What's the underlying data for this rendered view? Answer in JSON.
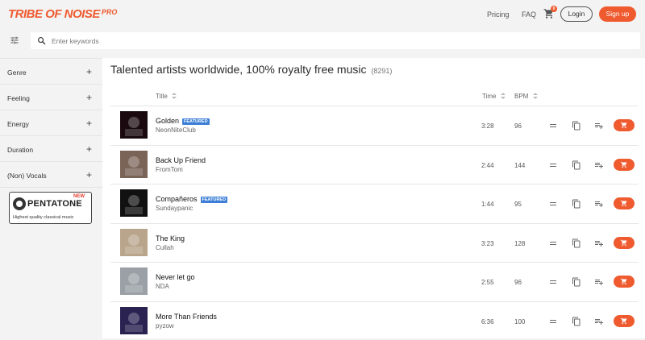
{
  "brand": {
    "name": "TRIBE OF NOISE",
    "tier": "PRO",
    "accent": "#ef5a2f"
  },
  "nav": {
    "pricing": "Pricing",
    "faq": "FAQ",
    "cart_count": "0",
    "login": "Login",
    "signup": "Sign up"
  },
  "search": {
    "placeholder": "Enter keywords",
    "value": ""
  },
  "sidebar": {
    "filters": [
      {
        "label": "Genre",
        "icon": "plus-icon"
      },
      {
        "label": "Feeling",
        "icon": "plus-icon"
      },
      {
        "label": "Energy",
        "icon": "plus-icon"
      },
      {
        "label": "Duration",
        "icon": "plus-icon"
      },
      {
        "label": "(Non) Vocals",
        "icon": "plus-icon"
      }
    ],
    "promo": {
      "badge": "NEW",
      "name": "PENTATONE",
      "tagline": "Highest quality classical music"
    }
  },
  "main": {
    "title": "Talented artists worldwide, 100% royalty free music",
    "count": "(8291)",
    "columns": {
      "title": "Title",
      "time": "Time",
      "bpm": "BPM"
    },
    "tracks": [
      {
        "title": "Golden",
        "featured": "FEATURED",
        "artist": "NeonNiteClub",
        "time": "3:28",
        "bpm": "96",
        "art_color": "#1a0a10"
      },
      {
        "title": "Back Up Friend",
        "featured": "",
        "artist": "FromTom",
        "time": "2:44",
        "bpm": "144",
        "art_color": "#7a6458"
      },
      {
        "title": "Compañeros",
        "featured": "FEATURED",
        "artist": "Sundaypanic",
        "time": "1:44",
        "bpm": "95",
        "art_color": "#111111"
      },
      {
        "title": "The King",
        "featured": "",
        "artist": "Cullah",
        "time": "3:23",
        "bpm": "128",
        "art_color": "#b9a58c"
      },
      {
        "title": "Never let go",
        "featured": "",
        "artist": "NDA",
        "time": "2:55",
        "bpm": "96",
        "art_color": "#9aa0a6"
      },
      {
        "title": "More Than Friends",
        "featured": "",
        "artist": "pyzow",
        "time": "6:36",
        "bpm": "100",
        "art_color": "#2a2352"
      }
    ]
  }
}
